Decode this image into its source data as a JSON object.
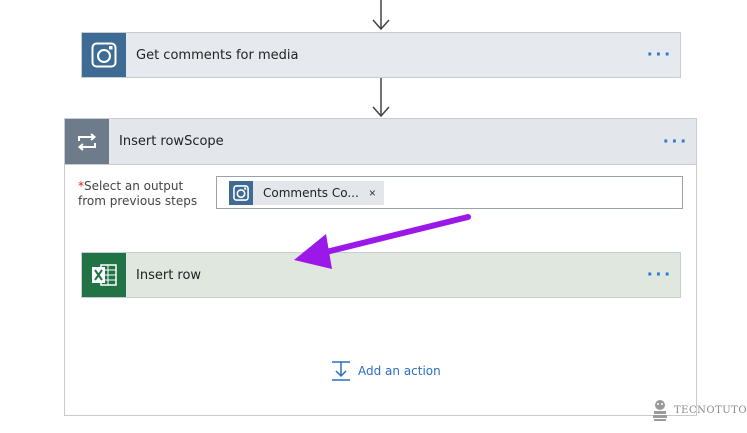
{
  "top_step": {
    "title": "Get comments for media",
    "icon": "instagram-icon",
    "more": "···"
  },
  "scope": {
    "title": "Insert rowScope",
    "icon": "loop-icon",
    "more": "···",
    "field": {
      "required_mark": "*",
      "label": "Select an output from previous steps",
      "token": {
        "text": "Comments Co...",
        "icon": "instagram-icon",
        "remove": "×"
      }
    },
    "inner_step": {
      "title": "Insert row",
      "icon": "excel-icon",
      "more": "···"
    },
    "add_action": {
      "label": "Add an action",
      "icon": "add-action-icon"
    }
  },
  "watermark": {
    "text": "TECNOTUTO"
  },
  "colors": {
    "instagram": "#3e6b93",
    "loop": "#6e7b8b",
    "excel": "#217346",
    "link": "#2b6fc2",
    "annotation_arrow": "#9b19e8"
  }
}
